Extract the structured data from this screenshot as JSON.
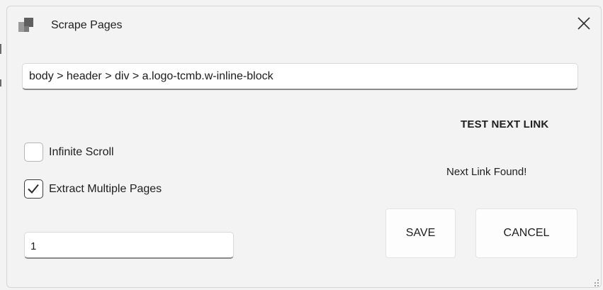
{
  "window": {
    "title": "Scrape Pages",
    "app_icon": "app-blocks-icon",
    "close_icon": "close-icon"
  },
  "selector": {
    "value": "body > header > div > a.logo-tcmb.w-inline-block"
  },
  "next_link": {
    "test_label": "TEST NEXT LINK",
    "status": "Next Link Found!"
  },
  "options": {
    "infinite_scroll": {
      "label": "Infinite Scroll",
      "checked": false
    },
    "extract_multiple": {
      "label": "Extract Multiple Pages",
      "checked": true
    }
  },
  "pages": {
    "value": "1"
  },
  "buttons": {
    "save": "SAVE",
    "cancel": "CANCEL"
  },
  "colors": {
    "background": "#f3f3f3",
    "input_bg": "#ffffff",
    "text": "#202020"
  }
}
